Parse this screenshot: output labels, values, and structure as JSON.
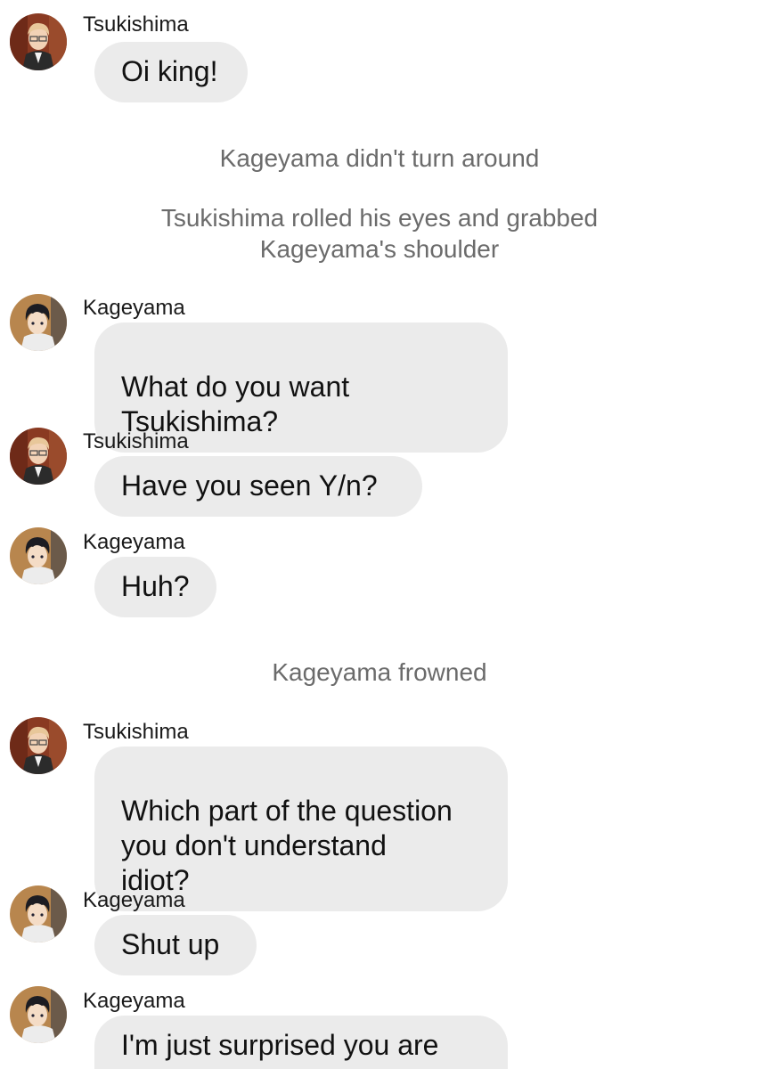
{
  "messages": [
    {
      "sender": "Tsukishima",
      "text": "Oi king!"
    },
    {
      "sender": "Kageyama",
      "text": "What do you want\nTsukishima?"
    },
    {
      "sender": "Tsukishima",
      "text": "Have you seen Y/n?"
    },
    {
      "sender": "Kageyama",
      "text": "Huh?"
    },
    {
      "sender": "Tsukishima",
      "text": "Which part of the question\nyou don't understand\nidiot?"
    },
    {
      "sender": "Kageyama",
      "text": "Shut up"
    },
    {
      "sender": "Kageyama",
      "text": "I'm just surprised you are"
    }
  ],
  "narrations": [
    "Kageyama didn't turn around",
    "Tsukishima rolled his eyes and grabbed\nKageyama's shoulder",
    "Kageyama frowned"
  ],
  "colors": {
    "bubble_bg": "#ebebeb",
    "narration_text": "#6b6b6b",
    "message_text": "#111111"
  },
  "icons": {
    "tsukishima": "avatar-tsukishima-icon",
    "kageyama": "avatar-kageyama-icon"
  }
}
